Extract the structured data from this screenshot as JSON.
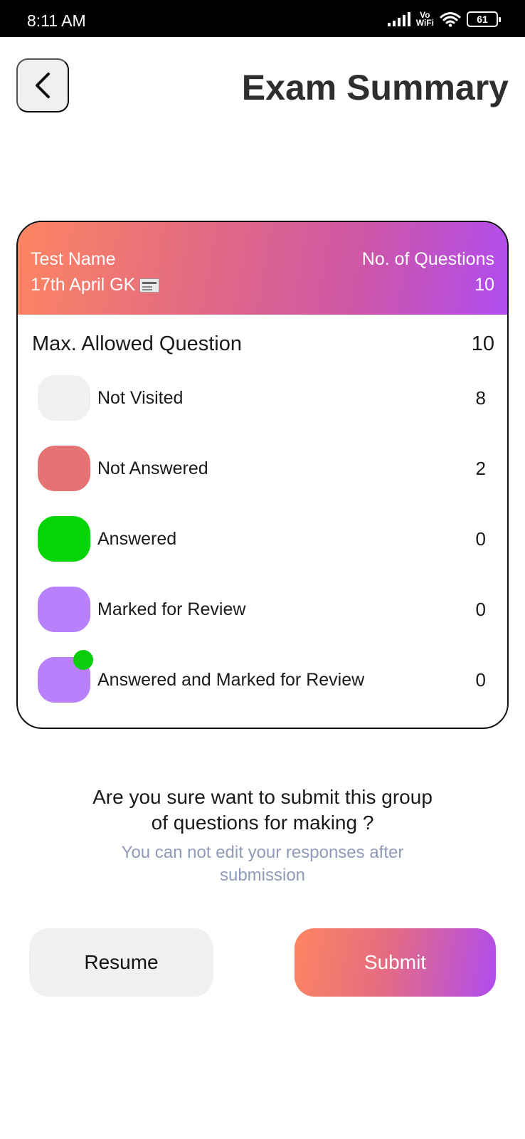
{
  "status_bar": {
    "time": "8:11 AM",
    "network_label": "Vo\nWiFi",
    "battery": "61"
  },
  "header": {
    "title": "Exam Summary",
    "back_icon": "chevron-left-icon"
  },
  "summary_card": {
    "test_name_label": "Test Name",
    "test_name": "17th April GK",
    "test_name_icon": "newspaper-icon",
    "questions_label": "No. of Questions",
    "questions_count": "10",
    "max_allowed_label": "Max. Allowed Question",
    "max_allowed_value": "10",
    "gradient_colors": [
      "#fd8561",
      "#cd56a8",
      "#b04cf0"
    ],
    "stats": [
      {
        "label": "Not Visited",
        "value": "8",
        "color": "#f0f0ee"
      },
      {
        "label": "Not Answered",
        "value": "2",
        "color": "#e57373"
      },
      {
        "label": "Answered",
        "value": "0",
        "color": "#05d405"
      },
      {
        "label": "Marked for Review",
        "value": "0",
        "color": "#b980fb"
      },
      {
        "label": "Answered and Marked for Review",
        "value": "0",
        "color": "#b980fb",
        "dot_color": "#0bcd0b"
      }
    ]
  },
  "confirmation": {
    "question_line1": "Are you sure want to submit this group",
    "question_line2": "of questions for making ?",
    "note_line1": "You can not edit your responses after",
    "note_line2": "submission"
  },
  "actions": {
    "resume_label": "Resume",
    "submit_label": "Submit"
  }
}
